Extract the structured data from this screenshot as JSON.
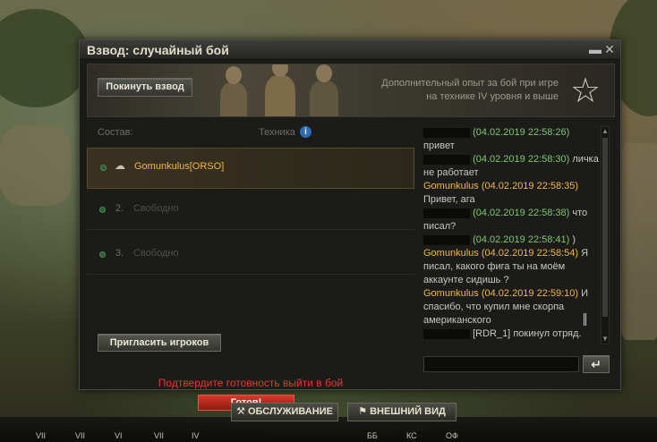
{
  "window": {
    "title": "Взвод: случайный бой",
    "minimize_glyph": "▬",
    "close_glyph": "✕"
  },
  "banner": {
    "leave_label": "Покинуть взвод",
    "bonus_text": "Дополнительный опыт за бой при игре на технике IV уровня и выше",
    "tier_icon": "star-badge-icon"
  },
  "roster": {
    "header_composition": "Состав:",
    "header_tech": "Техника",
    "info_icon": "i",
    "slots": [
      {
        "num": "",
        "label": "Gomunkulus[ORSO]",
        "active": true
      },
      {
        "num": "2.",
        "label": "Свободно",
        "active": false
      },
      {
        "num": "3.",
        "label": "Свободно",
        "active": false
      }
    ],
    "invite_label": "Пригласить игроков",
    "ready_hint": "Подтвердите готовность выйти в бой",
    "ready_label": "Готов!"
  },
  "chat": {
    "messages": [
      {
        "author": "",
        "time": "(04.02.2019 22:58:26)",
        "text": "привет"
      },
      {
        "author": "",
        "time": "(04.02.2019 22:58:30)",
        "text": "личка не работает"
      },
      {
        "author": "Gomunkulus",
        "time": "(04.02.2019 22:58:35)",
        "text": "Привет, ага"
      },
      {
        "author": "",
        "time": "(04.02.2019 22:58:38)",
        "text": "что писал?"
      },
      {
        "author": "",
        "time": "(04.02.2019 22:58:41)",
        "text": ")"
      },
      {
        "author": "Gomunkulus",
        "time": "(04.02.2019 22:58:54)",
        "text": "Я писал, какого фига ты на моём аккаунте сидишь ?"
      },
      {
        "author": "Gomunkulus",
        "time": "(04.02.2019 22:59:10)",
        "text": "И спасибо, что купил мне скорпа американского"
      },
      {
        "author": "",
        "time": "[RDR_1]",
        "text": "покинул отряд."
      }
    ],
    "input_value": "",
    "send_glyph": "↵"
  },
  "dock": {
    "service_label": "ОБСЛУЖИВАНИЕ",
    "exterior_label": "ВНЕШНИЙ ВИД",
    "tiers": [
      "VII",
      "VII",
      "VI",
      "VII",
      "IV"
    ],
    "ammo": [
      "ББ",
      "КС",
      "ОФ"
    ]
  },
  "colors": {
    "accent_gold": "#f0b83e",
    "ready_red": "#e33b2c",
    "timestamp_green": "#7ec76a"
  }
}
